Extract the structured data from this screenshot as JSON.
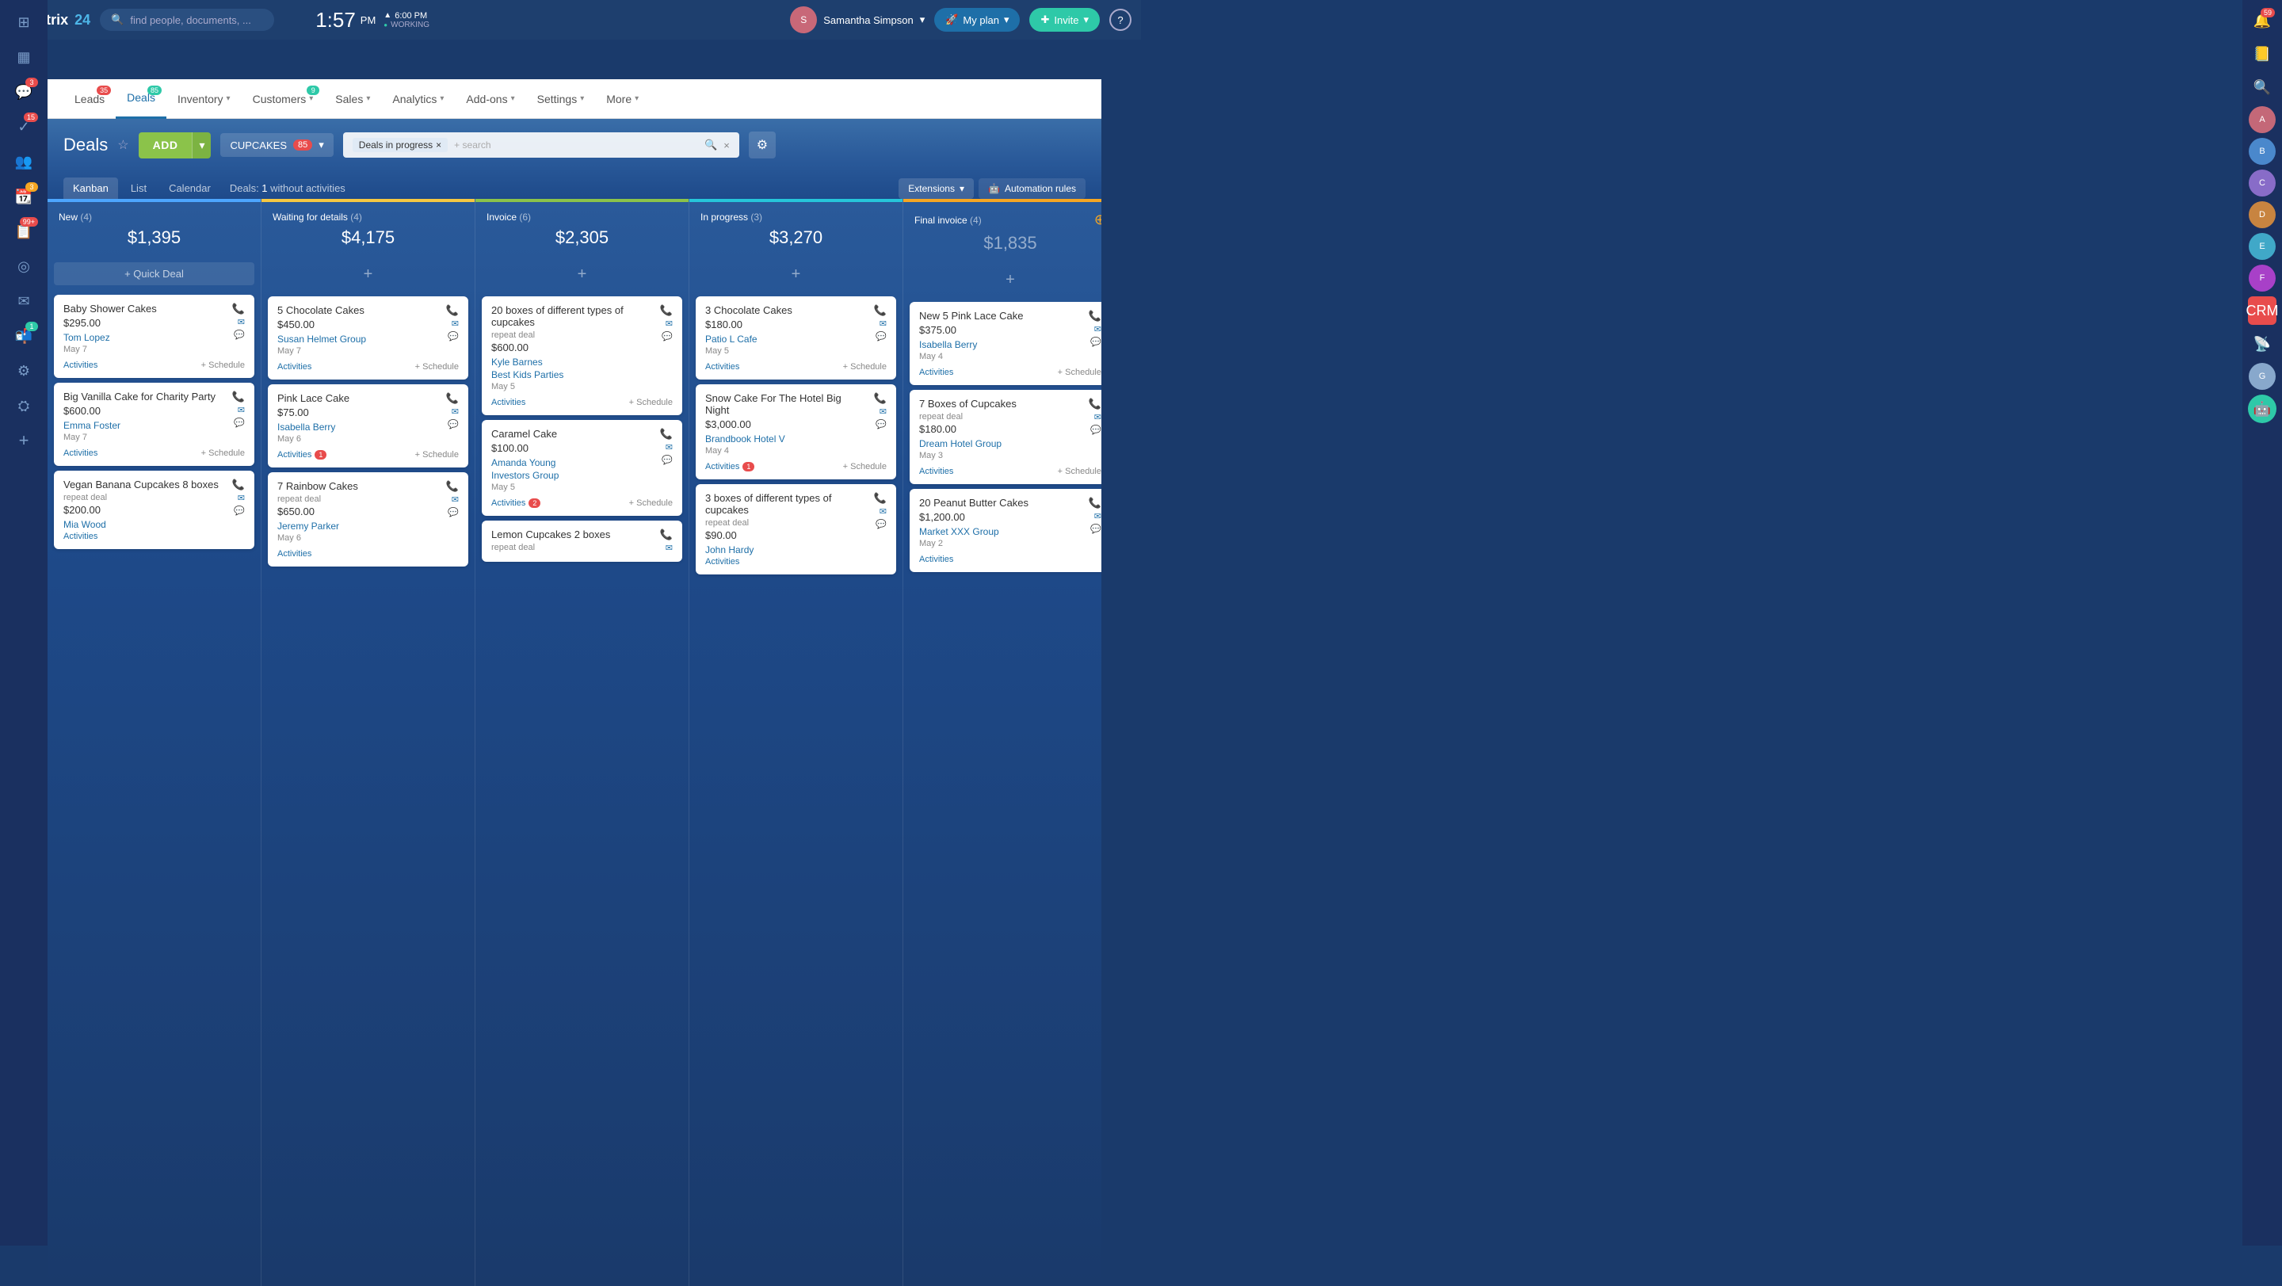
{
  "app": {
    "name": "Bitrix",
    "number": "24"
  },
  "topbar": {
    "search_placeholder": "find people, documents, ...",
    "time": "1:57",
    "time_period": "PM",
    "work_time": "6:00 PM",
    "work_status": "WORKING",
    "user_name": "Samantha Simpson",
    "plan_label": "My plan",
    "invite_label": "Invite",
    "help": "?"
  },
  "secondary_nav": {
    "items": [
      {
        "label": "Leads",
        "badge": "35",
        "badge_color": "red",
        "active": false,
        "has_arrow": false
      },
      {
        "label": "Deals",
        "badge": "85",
        "badge_color": "green",
        "active": true,
        "has_arrow": false
      },
      {
        "label": "Inventory",
        "badge": null,
        "active": false,
        "has_arrow": true
      },
      {
        "label": "Customers",
        "badge": "9",
        "badge_color": "green",
        "active": false,
        "has_arrow": true
      },
      {
        "label": "Sales",
        "badge": null,
        "active": false,
        "has_arrow": true
      },
      {
        "label": "Analytics",
        "badge": null,
        "active": false,
        "has_arrow": true
      },
      {
        "label": "Add-ons",
        "badge": null,
        "active": false,
        "has_arrow": true
      },
      {
        "label": "Settings",
        "badge": null,
        "active": false,
        "has_arrow": true
      },
      {
        "label": "More",
        "badge": null,
        "active": false,
        "has_arrow": true
      }
    ]
  },
  "deals_header": {
    "title": "Deals",
    "add_label": "ADD",
    "filter_label": "CUPCAKES",
    "filter_count": "85",
    "search_tag": "Deals in progress",
    "search_placeholder": "+ search"
  },
  "tabs": {
    "items": [
      {
        "label": "Kanban",
        "active": true
      },
      {
        "label": "List",
        "active": false
      },
      {
        "label": "Calendar",
        "active": false
      }
    ],
    "deals_label": "Deals:",
    "deals_count": "1",
    "deals_suffix": "without activities",
    "extensions_label": "Extensions",
    "automation_label": "Automation rules"
  },
  "columns": [
    {
      "id": "new",
      "title": "New",
      "count": 4,
      "amount": "$1,395",
      "color_class": "blue",
      "has_quick_deal": true,
      "cards": [
        {
          "title": "Baby Shower Cakes",
          "repeat": null,
          "amount": "$295.00",
          "amount2": null,
          "client": "Tom Lopez",
          "date": "May 7",
          "activities": "Activities",
          "activities_badge": null,
          "schedule": "+ Schedule"
        },
        {
          "title": "Big Vanilla Cake for Charity Party",
          "repeat": null,
          "amount": "$600.00",
          "amount2": null,
          "client": "Emma Foster",
          "date": "May 7",
          "activities": "Activities",
          "activities_badge": null,
          "schedule": "+ Schedule"
        },
        {
          "title": "Vegan Banana Cupcakes 8 boxes",
          "repeat": "repeat deal",
          "amount": "$200.00",
          "amount2": null,
          "client": "Mia Wood",
          "date": null,
          "activities": "Activities",
          "activities_badge": null,
          "schedule": null
        }
      ]
    },
    {
      "id": "waiting",
      "title": "Waiting for details",
      "count": 4,
      "amount": "$4,175",
      "color_class": "yellow",
      "has_quick_deal": false,
      "cards": [
        {
          "title": "5 Chocolate Cakes",
          "repeat": null,
          "amount": "$450.00",
          "amount2": null,
          "client": "Susan Helmet Group",
          "date": "May 7",
          "activities": "Activities",
          "activities_badge": null,
          "schedule": "+ Schedule"
        },
        {
          "title": "Pink Lace Cake",
          "repeat": null,
          "amount": "$75.00",
          "amount2": null,
          "client": "Isabella Berry",
          "date": "May 6",
          "activities": "Activities",
          "activities_badge": "1",
          "schedule": "+ Schedule"
        },
        {
          "title": "7 Rainbow Cakes",
          "repeat": "repeat deal",
          "amount": "$650.00",
          "amount2": null,
          "client": "Jeremy Parker",
          "date": "May 6",
          "activities": "Activities",
          "activities_badge": null,
          "schedule": null
        }
      ]
    },
    {
      "id": "invoice",
      "title": "Invoice",
      "count": 6,
      "amount": "$2,305",
      "color_class": "green",
      "has_quick_deal": false,
      "cards": [
        {
          "title": "20 boxes of different types of cupcakes",
          "repeat": "repeat deal",
          "amount": "$600.00",
          "amount2": null,
          "client": "Kyle Barnes",
          "client2": "Best Kids Parties",
          "date": "May 5",
          "activities": "Activities",
          "activities_badge": null,
          "schedule": "+ Schedule"
        },
        {
          "title": "Caramel Cake",
          "repeat": null,
          "amount": "$100.00",
          "amount2": null,
          "client": "Amanda Young",
          "client2": "Investors Group",
          "date": "May 5",
          "activities": "Activities",
          "activities_badge": "2",
          "schedule": "+ Schedule"
        },
        {
          "title": "Lemon Cupcakes 2 boxes",
          "repeat": "repeat deal",
          "amount": null,
          "amount2": null,
          "client": null,
          "date": null,
          "activities": null,
          "activities_badge": null,
          "schedule": null
        }
      ]
    },
    {
      "id": "in_progress",
      "title": "In progress",
      "count": 3,
      "amount": "$3,270",
      "color_class": "cyan",
      "has_quick_deal": false,
      "cards": [
        {
          "title": "3 Chocolate Cakes",
          "repeat": null,
          "amount": "$180.00",
          "amount2": null,
          "client": "Patio L Cafe",
          "date": "May 5",
          "activities": "Activities",
          "activities_badge": null,
          "schedule": "+ Schedule"
        },
        {
          "title": "Snow Cake For The Hotel Big Night",
          "repeat": null,
          "amount": "$3,000.00",
          "amount2": null,
          "client": "Brandbook Hotel V",
          "date": "May 4",
          "activities": "Activities",
          "activities_badge": "1",
          "schedule": "+ Schedule"
        },
        {
          "title": "3 boxes of different types of cupcakes",
          "repeat": "repeat deal",
          "amount": "$90.00",
          "amount2": null,
          "client": "John Hardy",
          "date": null,
          "activities": "Activities",
          "activities_badge": null,
          "schedule": null
        }
      ]
    },
    {
      "id": "final_invoice",
      "title": "Final invoice",
      "count": 4,
      "amount": "$1,835",
      "color_class": "orange",
      "amount_muted": true,
      "has_quick_deal": false,
      "cards": [
        {
          "title": "New 5 Pink Lace Cake",
          "repeat": null,
          "amount": "$375.00",
          "amount2": null,
          "client": "Isabella Berry",
          "date": "May 4",
          "activities": "Activities",
          "activities_badge": null,
          "schedule": "+ Schedule"
        },
        {
          "title": "7 Boxes of Cupcakes",
          "repeat": "repeat deal",
          "amount": "$180.00",
          "amount2": null,
          "client": "Dream Hotel Group",
          "date": "May 3",
          "activities": "Activities",
          "activities_badge": null,
          "schedule": "+ Schedule"
        },
        {
          "title": "20 Peanut Butter Cakes",
          "repeat": null,
          "amount": "$1,200.00",
          "amount2": null,
          "client": "Market XXX Group",
          "date": "May 2",
          "activities": "Activities",
          "activities_badge": null,
          "schedule": null
        }
      ]
    }
  ],
  "sidebar_left": {
    "icons": [
      {
        "name": "grid-icon",
        "symbol": "⊞",
        "badge": null
      },
      {
        "name": "calendar-icon",
        "symbol": "📅",
        "badge": null
      },
      {
        "name": "chat-icon",
        "symbol": "💬",
        "badge": "3"
      },
      {
        "name": "tasks-icon",
        "symbol": "✓",
        "badge": "15"
      },
      {
        "name": "contacts-icon",
        "symbol": "👥",
        "badge": null
      },
      {
        "name": "calendar2-icon",
        "symbol": "📆",
        "badge": "3"
      },
      {
        "name": "crm-icon",
        "symbol": "📋",
        "badge": "99+"
      },
      {
        "name": "target-icon",
        "symbol": "◎",
        "badge": null
      },
      {
        "name": "email-icon",
        "symbol": "✉",
        "badge": null
      },
      {
        "name": "mail-icon",
        "symbol": "📬",
        "badge": "1"
      },
      {
        "name": "tools-icon",
        "symbol": "🔧",
        "badge": null
      },
      {
        "name": "settings-icon",
        "symbol": "⚙",
        "badge": null
      },
      {
        "name": "add-icon",
        "symbol": "+",
        "badge": null
      }
    ]
  },
  "sidebar_right": {
    "notification_badge": "59",
    "icons": [
      {
        "name": "notification-icon",
        "symbol": "🔔",
        "badge": "59"
      },
      {
        "name": "contact-book-icon",
        "symbol": "📒",
        "badge": null
      },
      {
        "name": "search-icon",
        "symbol": "🔍",
        "badge": null
      }
    ],
    "avatars": [
      {
        "name": "avatar-1",
        "initials": "A",
        "color": "#c46"
      },
      {
        "name": "avatar-2",
        "initials": "B",
        "color": "#4a8"
      },
      {
        "name": "avatar-3",
        "initials": "C",
        "color": "#88c"
      },
      {
        "name": "avatar-4",
        "initials": "D",
        "color": "#c84"
      },
      {
        "name": "avatar-5",
        "initials": "E",
        "color": "#4ac"
      },
      {
        "name": "avatar-6",
        "initials": "F",
        "color": "#a4c"
      }
    ]
  }
}
